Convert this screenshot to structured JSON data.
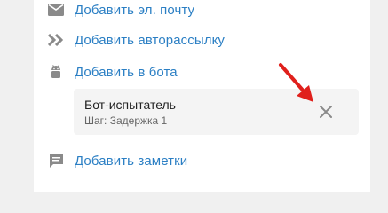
{
  "actions": {
    "email": {
      "label": "Добавить эл. почту",
      "icon": "mail-icon"
    },
    "autoresponder": {
      "label": "Добавить авторассылку",
      "icon": "double-chevron-icon"
    },
    "bot": {
      "label": "Добавить в бота",
      "icon": "android-icon"
    },
    "notes": {
      "label": "Добавить заметки",
      "icon": "note-icon"
    }
  },
  "bot_card": {
    "title": "Бот-испытатель",
    "subtitle": "Шаг: Задержка 1",
    "remove_icon": "close-icon"
  },
  "colors": {
    "link": "#2b7fc4",
    "icon": "#8a8a8a",
    "card_bg": "#f4f4f4",
    "annotation_arrow": "#e0201c"
  }
}
